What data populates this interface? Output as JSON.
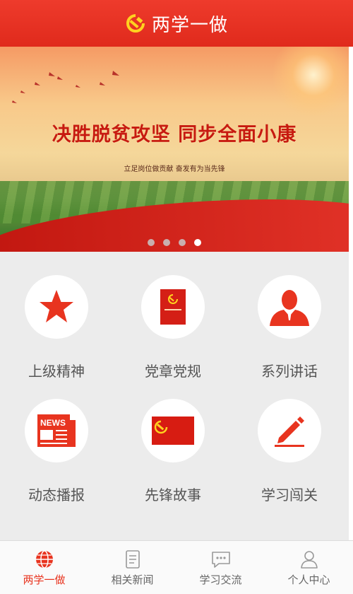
{
  "header": {
    "title": "两学一做"
  },
  "banner": {
    "slogan": "决胜脱贫攻坚  同步全面小康",
    "subslogan": "立足岗位做贡献    奋发有为当先锋",
    "dots": 4,
    "active_dot": 4
  },
  "grid": {
    "items": [
      {
        "label": "上级精神",
        "icon": "star-icon"
      },
      {
        "label": "党章党规",
        "icon": "party-book-icon"
      },
      {
        "label": "系列讲话",
        "icon": "person-icon"
      },
      {
        "label": "动态播报",
        "icon": "news-icon"
      },
      {
        "label": "先锋故事",
        "icon": "party-flag-icon"
      },
      {
        "label": "学习闯关",
        "icon": "pencil-icon"
      }
    ]
  },
  "tabbar": {
    "tabs": [
      {
        "label": "两学一做",
        "icon": "globe-icon",
        "active": true
      },
      {
        "label": "相关新闻",
        "icon": "document-icon",
        "active": false
      },
      {
        "label": "学习交流",
        "icon": "chat-icon",
        "active": false
      },
      {
        "label": "个人中心",
        "icon": "user-icon",
        "active": false
      }
    ]
  },
  "colors": {
    "primary": "#e8341f",
    "header_bg": "#e8352a",
    "grid_bg": "#ececec"
  }
}
